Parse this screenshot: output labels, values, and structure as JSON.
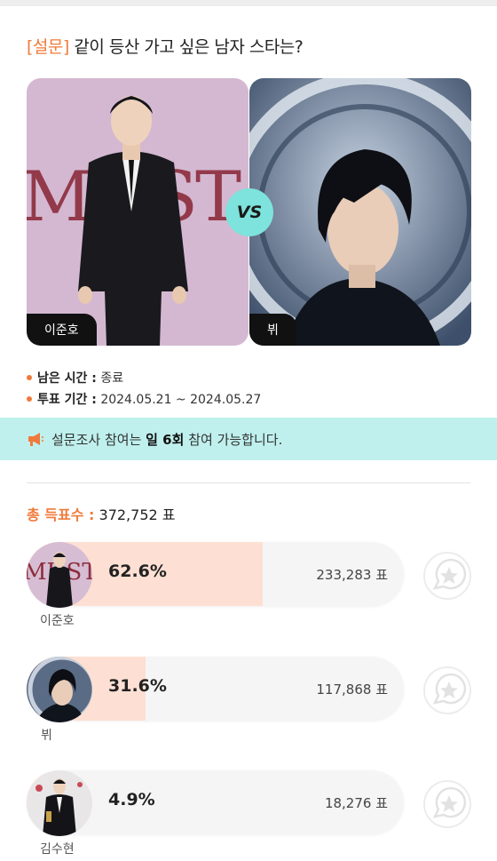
{
  "poll": {
    "tag": "[설문]",
    "question": "같이 등산 가고 싶은 남자 스타는?",
    "vs_label": "VS",
    "matchup": [
      {
        "name": "이준호",
        "photo": "man-in-black-suit-photo"
      },
      {
        "name": "뷔",
        "photo": "man-dark-hair-portrait-photo"
      }
    ]
  },
  "info": {
    "remaining_label": "남은 시간 :",
    "remaining_value": "종료",
    "period_label": "투표 기간 :",
    "period_value": "2024.05.21 ~ 2024.05.27"
  },
  "notice": {
    "prefix": "설문조사 참여는",
    "highlight": "일 6회",
    "suffix": "참여 가능합니다.",
    "icon": "megaphone-icon"
  },
  "results": {
    "total_label": "총 득표수 :",
    "total_value": "372,752 표",
    "candidates": [
      {
        "name": "이준호",
        "percent_text": "62.6%",
        "percent": 62.6,
        "votes": "233,283 표",
        "fill": 0.626
      },
      {
        "name": "뷔",
        "percent_text": "31.6%",
        "percent": 31.6,
        "votes": "117,868 표",
        "fill": 0.316
      },
      {
        "name": "김수현",
        "percent_text": "4.9%",
        "percent": 4.9,
        "votes": "18,276 표",
        "fill": 0.049
      }
    ]
  },
  "colors": {
    "accent": "#f07a3a",
    "notice_bg": "#bff0ed",
    "vs_bg": "#7de3dc",
    "bar_fill": "#fde0d3"
  }
}
